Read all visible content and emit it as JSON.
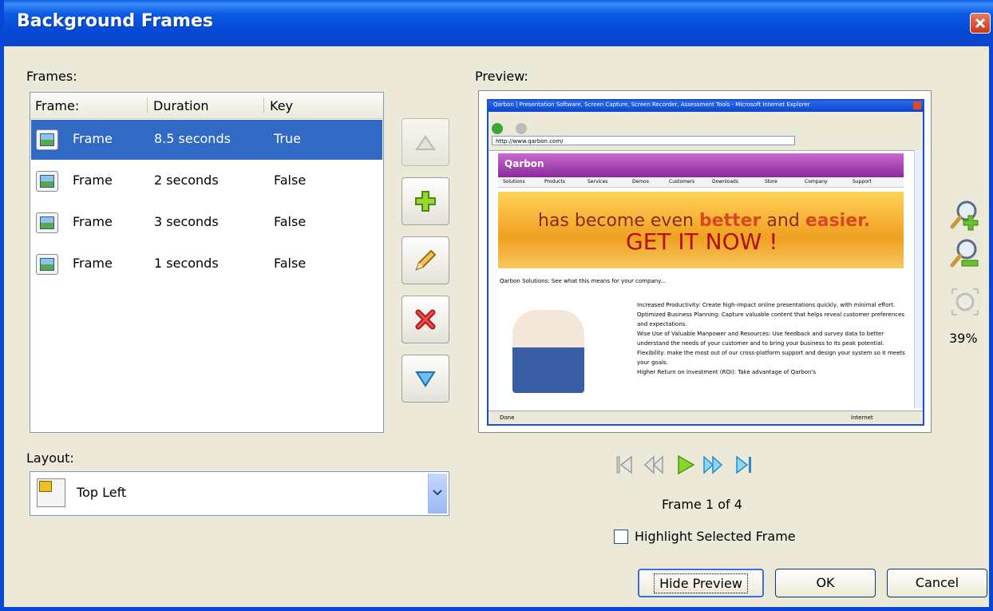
{
  "window": {
    "title": "Background Frames"
  },
  "frames_label": "Frames:",
  "preview_label": "Preview:",
  "table": {
    "headers": {
      "frame": "Frame:",
      "duration": "Duration",
      "key": "Key"
    },
    "rows": [
      {
        "name": "Frame",
        "duration": "8.5 seconds",
        "key": "True"
      },
      {
        "name": "Frame",
        "duration": "2 seconds",
        "key": "False"
      },
      {
        "name": "Frame",
        "duration": "3 seconds",
        "key": "False"
      },
      {
        "name": "Frame",
        "duration": "1 seconds",
        "key": "False"
      }
    ]
  },
  "layout": {
    "label": "Layout:",
    "value": "Top Left"
  },
  "zoom": {
    "value": "39%"
  },
  "frame_counter": "Frame 1 of 4",
  "highlight": {
    "label": "Highlight Selected Frame",
    "checked": false
  },
  "buttons": {
    "hide_preview": "Hide Preview",
    "ok": "OK",
    "cancel": "Cancel"
  },
  "preview_content": {
    "browser_title": "Qarbon | Presentation Software, Screen Capture, Screen Recorder, Assessment Tools - Microsoft Internet Explorer",
    "address": "http://www.qarbon.com/",
    "logo": "Qarbon",
    "nav": [
      "Solutions",
      "Products",
      "Services",
      "Demos",
      "Customers",
      "Downloads",
      "Store",
      "Company",
      "Support"
    ],
    "banner_line1": "has become even",
    "banner_better": "better",
    "banner_and": "and",
    "banner_easier": "easier.",
    "banner_cta": "GET IT NOW !",
    "solutions_heading": "Qarbon Solutions: See what this means for your company...",
    "bullets": [
      "Increased Productivity: Create high-impact online presentations quickly, with minimal effort.",
      "Optimized Business Planning: Capture valuable content that helps reveal customer preferences and expectations.",
      "Wise Use of Valuable Manpower and Resources: Use feedback and survey data to better understand the needs of your customer and to bring your business to its peak potential.",
      "Flexibility: make the most out of our cross-platform support and design your system so it meets your goals.",
      "Higher Return on Investment (ROI): Take advantage of Qarbon's"
    ],
    "status_done": "Done",
    "status_zone": "Internet"
  }
}
